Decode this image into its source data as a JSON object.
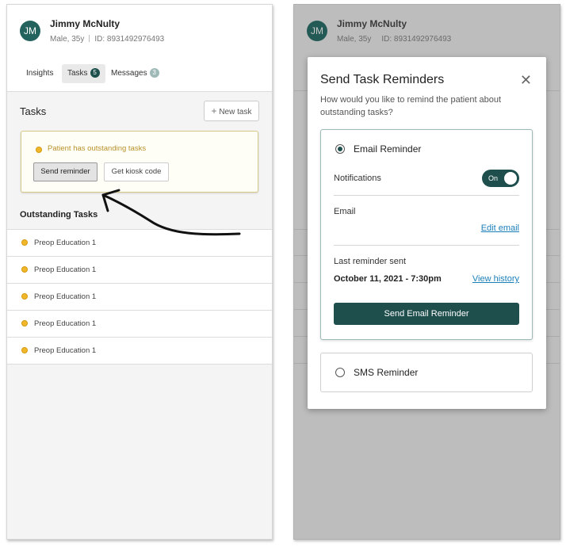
{
  "patient": {
    "initials": "JM",
    "name": "Jimmy McNulty",
    "gender_age": "Male, 35y",
    "id": "ID: 8931492976493"
  },
  "tabs": [
    {
      "label": "Insights"
    },
    {
      "label": "Tasks",
      "badge": "5"
    },
    {
      "label": "Messages",
      "badge": "3"
    }
  ],
  "tasks": {
    "title": "Tasks",
    "new_task_icon": "plus-icon",
    "new_task_label": "New task",
    "alert_text": "Patient has outstanding tasks",
    "send_reminder_label": "Send reminder",
    "kiosk_label": "Get kiosk code",
    "outstanding_title": "Outstanding Tasks",
    "items": [
      {
        "label": "Preop Education 1"
      },
      {
        "label": "Preop Education 1"
      },
      {
        "label": "Preop Education 1"
      },
      {
        "label": "Preop Education 1"
      },
      {
        "label": "Preop Education 1"
      }
    ]
  },
  "modal": {
    "title": "Send Task Reminders",
    "close_icon": "close-icon",
    "close_glyph": "✕",
    "subtitle": "How would you like to remind the patient about outstanding tasks?",
    "email": {
      "label": "Email Reminder",
      "notifications_label": "Notifications",
      "toggle_label": "On",
      "email_label": "Email",
      "edit_email_label": "Edit email",
      "last_sent_label": "Last reminder sent",
      "last_sent_value": "October 11, 2021 - 7:30pm",
      "view_history_label": "View history",
      "send_button_label": "Send Email Reminder"
    },
    "sms": {
      "label": "SMS Reminder"
    }
  },
  "colors": {
    "primary": "#1e4f4d",
    "alert": "#b8922a",
    "link": "#1b7fb9"
  }
}
